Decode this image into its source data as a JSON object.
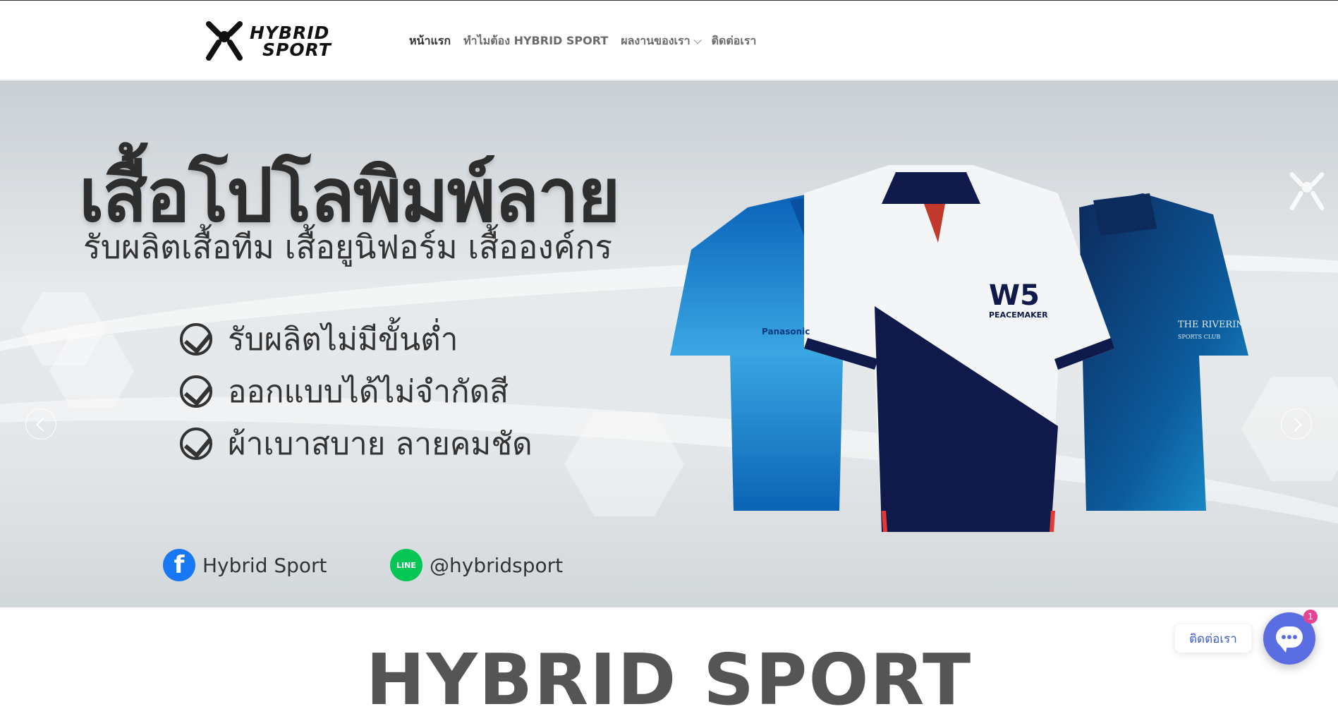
{
  "header": {
    "logo_line1": "HYBRID",
    "logo_line2": "SPORT",
    "nav": [
      {
        "label": "หน้าแรก"
      },
      {
        "label": "ทำไมต้อง HYBRID SPORT"
      },
      {
        "label": "ผลงานของเรา"
      },
      {
        "label": "ติดต่อเรา"
      }
    ]
  },
  "banner": {
    "title": "เสื้อโปโลพิมพ์ลาย",
    "subtitle": "รับผลิตเสื้อทีม เสื้อยูนิฟอร์ม เสื้อองค์กร",
    "features": [
      "รับผลิตไม่มีขั้นต่ำ",
      "ออกแบบได้ไม่จำกัดสี",
      "ผ้าเบาสบาย ลายคมชัด"
    ],
    "facebook_label": "Hybrid Sport",
    "line_label": "@hybridsport",
    "line_icon_text": "LINE",
    "shirt_left_brand": "Panasonic",
    "shirt_center_brand": "W5",
    "shirt_center_sub": "PEACEMAKER",
    "shirt_right_brand": "THE RIVERINE",
    "shirt_right_sub": "SPORTS CLUB",
    "active_slide": 2,
    "slide_count": 3
  },
  "section": {
    "title": "HYBRID SPORT"
  },
  "chat": {
    "label": "ติดต่อเรา",
    "badge": "1"
  },
  "colors": {
    "navy": "#0f1a4a",
    "blue": "#0a73c8",
    "facebook": "#1877f2",
    "line": "#06c755",
    "chat": "#5b6ee1"
  }
}
